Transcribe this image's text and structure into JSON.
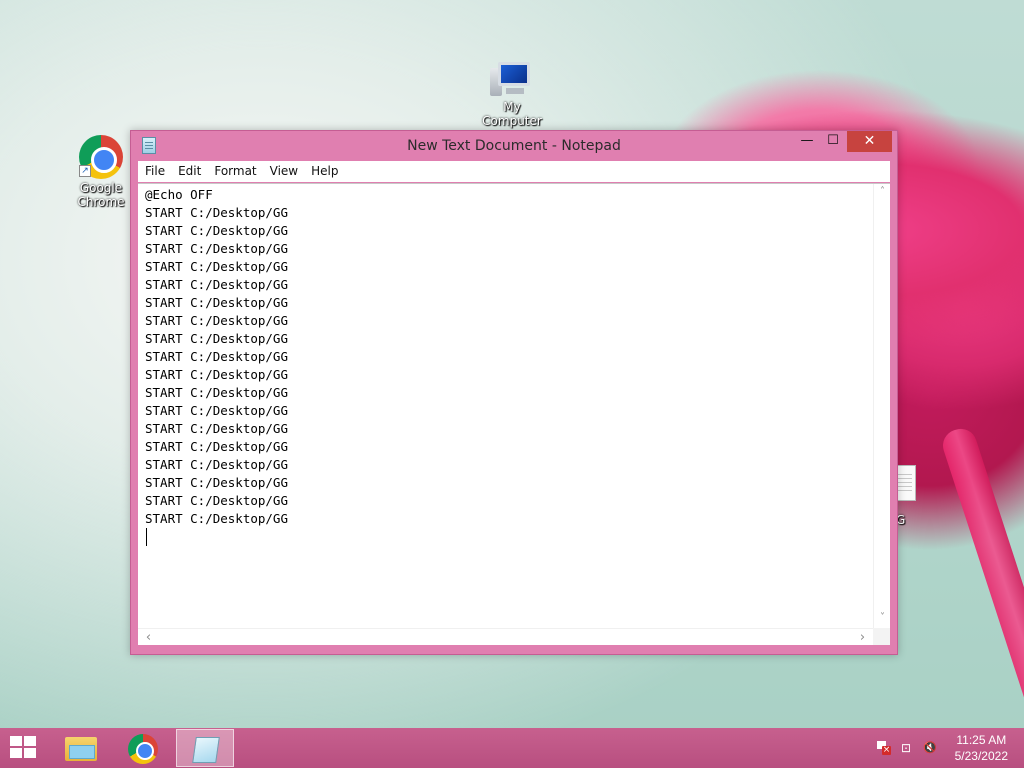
{
  "desktop": {
    "icons": {
      "chrome": {
        "label_line1": "Google",
        "label_line2": "Chrome"
      },
      "computer": {
        "label": "My Computer"
      },
      "file": {
        "label_visible": "G"
      }
    }
  },
  "window": {
    "title": "New Text Document - Notepad",
    "controls": {
      "minimize": "—",
      "maximize": "☐",
      "close": "✕"
    },
    "menu": [
      "File",
      "Edit",
      "Format",
      "View",
      "Help"
    ],
    "content_lines": [
      "@Echo OFF",
      "START C:/Desktop/GG",
      "START C:/Desktop/GG",
      "START C:/Desktop/GG",
      "START C:/Desktop/GG",
      "START C:/Desktop/GG",
      "START C:/Desktop/GG",
      "START C:/Desktop/GG",
      "START C:/Desktop/GG",
      "START C:/Desktop/GG",
      "START C:/Desktop/GG",
      "START C:/Desktop/GG",
      "START C:/Desktop/GG",
      "START C:/Desktop/GG",
      "START C:/Desktop/GG",
      "START C:/Desktop/GG",
      "START C:/Desktop/GG",
      "START C:/Desktop/GG",
      "START C:/Desktop/GG"
    ],
    "scroll_arrows": {
      "up": "˄",
      "down": "˅",
      "left": "‹",
      "right": "›"
    }
  },
  "taskbar": {
    "items": [
      {
        "name": "file-explorer",
        "icon": "folder-icon",
        "active": false
      },
      {
        "name": "google-chrome",
        "icon": "chrome-icon",
        "active": false
      },
      {
        "name": "notepad",
        "icon": "notepad-icon",
        "active": true
      }
    ],
    "tray": {
      "flag_icon": "action-center-flag-icon",
      "network_icon": "network-icon",
      "volume_icon": "volume-muted-icon",
      "network_glyph": "⊡",
      "volume_glyph": "🔇"
    },
    "clock": {
      "time": "11:25 AM",
      "date": "5/23/2022"
    }
  },
  "colors": {
    "window_frame": "#e07fb0",
    "close_button": "#c7433f",
    "taskbar": "#c7608e"
  }
}
